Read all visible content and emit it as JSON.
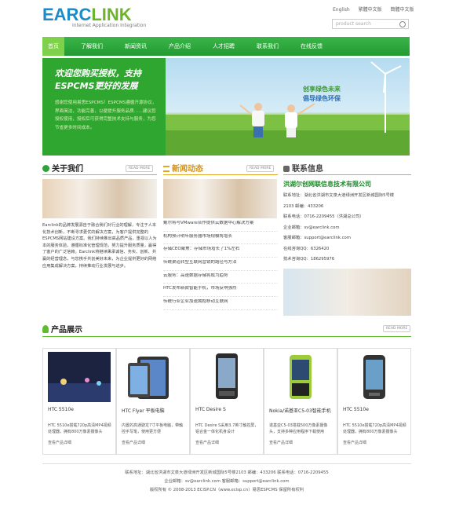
{
  "header": {
    "logo_main_1": "EARC",
    "logo_main_2": "LINK",
    "logo_sub": "Internet Application Integration",
    "lang": [
      "English",
      "繁體中文版",
      "簡體中文版"
    ],
    "search_placeholder": "product search"
  },
  "nav": {
    "items": [
      "首页",
      "了解我们",
      "新闻资讯",
      "产品介绍",
      "人才招聘",
      "联系我们",
      "在线反馈"
    ]
  },
  "banner": {
    "title_line1": "欢迎您购买授权，支持",
    "title_line2": "ESPCMS更好的发展",
    "body": "感谢您使用易思ESPCMS！ESPCMS遵循开源协议，界面简洁，功能完善，以便提升服务品质……建议您授权使用，授权后可获得完整技术支持与服务，为您节省更多时间成本。",
    "slogan1": "创享绿色未来",
    "slogan2": "倡导绿色环保"
  },
  "about": {
    "title": "关于我们",
    "more": "READ MORE",
    "text": "Earclink的品牌发展源自于融合我们对行业的理解，专注于人本化技术创新，不断寻求更优的解决方案，为客户提供完整的ESPCMS网站建设方案。我们持续推出高品质产品，重视以人为本的服务体验，遵循标准化管理规范，努力提升服务质量，赢得了客户的广泛信赖。Earclink将继续秉承诚信、务实、创新、共赢的经营理念，与您携手共创美好未来，为企业提供更好的网络应用集成解决方案，持续推动行业发展与进步。"
  },
  "news": {
    "title": "新闻动态",
    "more": "READ MORE",
    "items": [
      "戴尔将与VMware合作提供云数据中心解决方案",
      "机构预计明年服务器市场规模将增长",
      "存储CEO聚焦：存储市场增长了1%左右",
      "传统渠道转型互联网营销的路径与方法",
      "云服务：高速数据存储将成为趋势",
      "HTC发布新款智能手机，市场反响强烈",
      "传统行业企业加速拥抱移动互联网"
    ]
  },
  "contact": {
    "title": "联系信息",
    "company": "洪湖尔创网联信息技术有限公司",
    "lines": [
      "联系地址：湖北省洪湖市文泉大道绿洲开发区新城国际5号楼",
      "2103 邮编：433206",
      "联系电话：0716-2209455（洪湖总公司）",
      "企业邮箱：sv@earclink.com",
      "客服邮箱：support@earclink.com",
      "在线咨询QQ：6326420",
      "技术咨询QQ：186295976"
    ]
  },
  "products": {
    "title": "产品展示",
    "more": "READ MORE",
    "items": [
      {
        "name": "HTC 5510e",
        "desc": "HTC 5510e搭载720p高清MP4视频处理器，拥有800万像素摄像头",
        "link": "查看产品详细"
      },
      {
        "name": "HTC Flyer 平板电脑",
        "desc": "内置的高通骁龙7寸平板电脑，带触控手写笔，使用更方便",
        "link": "查看产品详细"
      },
      {
        "name": "HTC Desire S",
        "desc": "HTC Desire S采用3.7英寸触控屏，铝合金一体化机身设计",
        "link": "查看产品详细"
      },
      {
        "name": "Nokia/诺基亚C5-03智能手机",
        "desc": "诺基亚C5-03搭载500万像素摄像头，支持多种应用程序下载使用",
        "link": "查看产品详细"
      },
      {
        "name": "HTC 5510e",
        "desc": "HTC 5510e搭载720p高清MP4视频处理器，拥有800万像素摄像头",
        "link": "查看产品详细"
      }
    ]
  },
  "footer": {
    "line1": "联系地址：湖北省洪湖市文泉大道绿洲开发区新城国际5号楼2103 邮编：433206 联系电话：0716-2209455",
    "line2": "企业邮箱：sv@earclink.com 客服邮箱：support@earclink.com",
    "line3": "版权所有 © 2008-2013 ECISP.CN（www.ecisp.cn）易思ESPCMS 保留所有权利"
  }
}
